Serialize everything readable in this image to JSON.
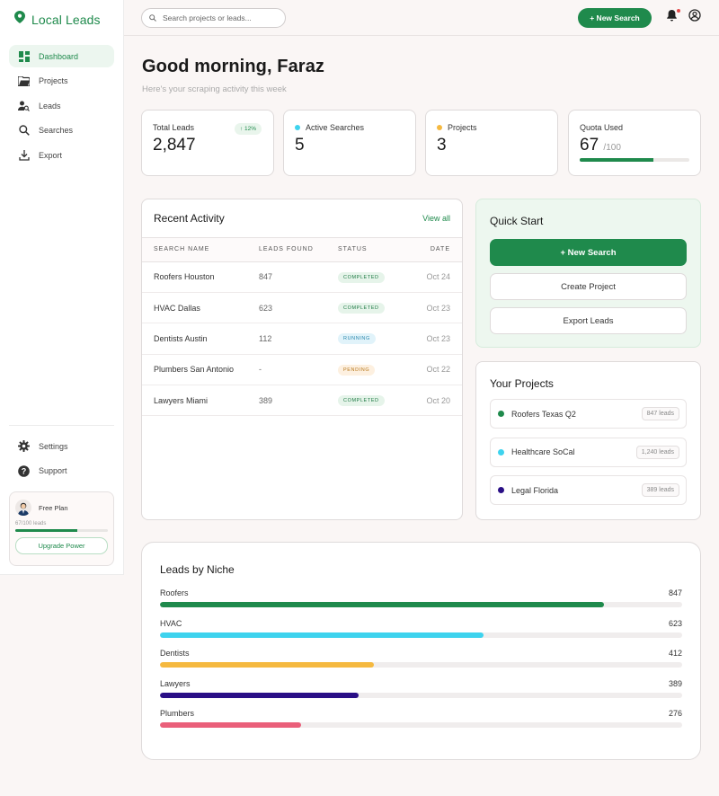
{
  "app": {
    "name": "Local Leads",
    "brand_color": "#1f8a4c"
  },
  "sidebar": {
    "items": [
      {
        "label": "Dashboard",
        "icon": "dashboard-icon",
        "active": true
      },
      {
        "label": "Projects",
        "icon": "folder-icon"
      },
      {
        "label": "Leads",
        "icon": "person-search-icon"
      },
      {
        "label": "Searches",
        "icon": "search-icon"
      },
      {
        "label": "Export",
        "icon": "download-icon"
      }
    ],
    "bottom_items": [
      {
        "label": "Settings",
        "icon": "gear-icon"
      },
      {
        "label": "Support",
        "icon": "help-icon"
      }
    ],
    "plan": {
      "name": "Free Plan",
      "usage_text": "67/100 leads",
      "usage_fraction": 0.67,
      "upgrade_label": "Upgrade Power"
    }
  },
  "topbar": {
    "search_placeholder": "Search projects or leads...",
    "new_search_label": "+ New Search"
  },
  "greeting": {
    "title": "Good morning, Faraz",
    "subtitle": "Here's your scraping activity this week"
  },
  "stats": {
    "total_leads": {
      "label": "Total Leads",
      "value": "2,847",
      "trend": "↑ 12%"
    },
    "active_searches": {
      "label": "Active Searches",
      "value": "5",
      "dot_color": "#3ed3ee"
    },
    "projects": {
      "label": "Projects",
      "value": "3",
      "dot_color": "#f5b940"
    },
    "quota": {
      "label": "Quota Used",
      "value": "67",
      "max": "/100",
      "fraction": 0.67
    }
  },
  "recent_activity": {
    "title": "Recent Activity",
    "view_all": "View all",
    "columns": [
      "SEARCH NAME",
      "LEADS FOUND",
      "STATUS",
      "DATE"
    ],
    "rows": [
      {
        "name": "Roofers Houston",
        "leads": "847",
        "status": "COMPLETED",
        "kind": "completed",
        "date": "Oct 24"
      },
      {
        "name": "HVAC Dallas",
        "leads": "623",
        "status": "COMPLETED",
        "kind": "completed",
        "date": "Oct 23"
      },
      {
        "name": "Dentists Austin",
        "leads": "112",
        "status": "RUNNING",
        "kind": "running",
        "date": "Oct 23"
      },
      {
        "name": "Plumbers San Antonio",
        "leads": "-",
        "status": "PENDING",
        "kind": "pending",
        "date": "Oct 22"
      },
      {
        "name": "Lawyers Miami",
        "leads": "389",
        "status": "COMPLETED",
        "kind": "completed",
        "date": "Oct 20"
      }
    ]
  },
  "quick_start": {
    "title": "Quick Start",
    "new_search": "+  New Search",
    "create_project": "Create Project",
    "export_leads": "Export Leads"
  },
  "your_projects": {
    "title": "Your Projects",
    "items": [
      {
        "name": "Roofers Texas Q2",
        "count": "847 leads",
        "color": "#1f8a4c"
      },
      {
        "name": "Healthcare SoCal",
        "count": "1,240 leads",
        "color": "#3ed3ee"
      },
      {
        "name": "Legal Florida",
        "count": "389 leads",
        "color": "#2a0f86"
      }
    ]
  },
  "leads_by_niche": {
    "title": "Leads by Niche",
    "max": 1000,
    "items": [
      {
        "label": "Roofers",
        "value": "847",
        "fraction": 0.85,
        "color": "#1f8a4c"
      },
      {
        "label": "HVAC",
        "value": "623",
        "fraction": 0.62,
        "color": "#3ed3ee"
      },
      {
        "label": "Dentists",
        "value": "412",
        "fraction": 0.41,
        "color": "#f5b940"
      },
      {
        "label": "Lawyers",
        "value": "389",
        "fraction": 0.38,
        "color": "#2a0f86"
      },
      {
        "label": "Plumbers",
        "value": "276",
        "fraction": 0.27,
        "color": "#ea5f7a"
      }
    ]
  }
}
